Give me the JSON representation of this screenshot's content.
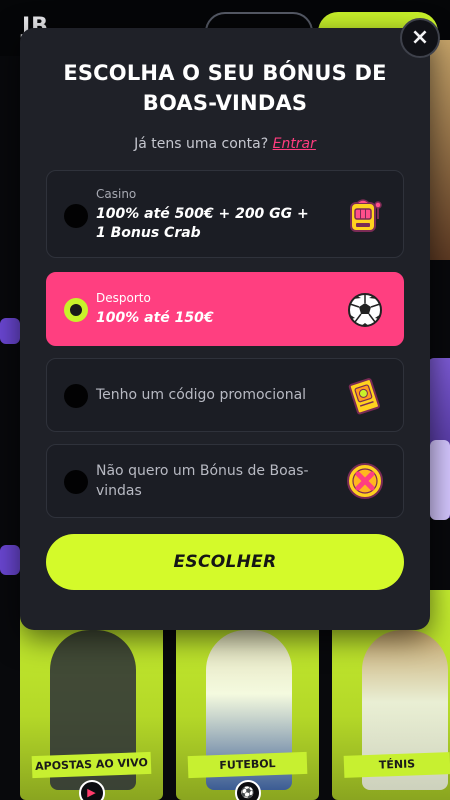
{
  "background": {
    "logo": "JB",
    "categories": [
      {
        "label": "APOSTAS AO VIVO"
      },
      {
        "label": "FUTEBOL"
      },
      {
        "label": "TÉNIS"
      }
    ]
  },
  "modal": {
    "title": "ESCOLHA O SEU BÓNUS DE BOAS-VINDAS",
    "login_prompt": "Já tens uma conta?",
    "login_link": "Entrar",
    "close_label": "×",
    "options": [
      {
        "category": "Casino",
        "text": "100% até 500€ + 200 GG + 1 Bonus Crab",
        "icon": "slot-machine-icon",
        "selected": false
      },
      {
        "category": "Desporto",
        "text": "100% até 150€",
        "icon": "soccer-ball-icon",
        "selected": true
      },
      {
        "category": "",
        "text": "Tenho um código promocional",
        "icon": "promo-ticket-icon",
        "selected": false
      },
      {
        "category": "",
        "text": "Não quero um Bónus de Boas-vindas",
        "icon": "no-bonus-coin-icon",
        "selected": false
      }
    ],
    "choose_button": "ESCOLHER"
  },
  "colors": {
    "accent_lime": "#d4fa2a",
    "accent_pink": "#ff3f80",
    "modal_bg": "#1f2128"
  }
}
